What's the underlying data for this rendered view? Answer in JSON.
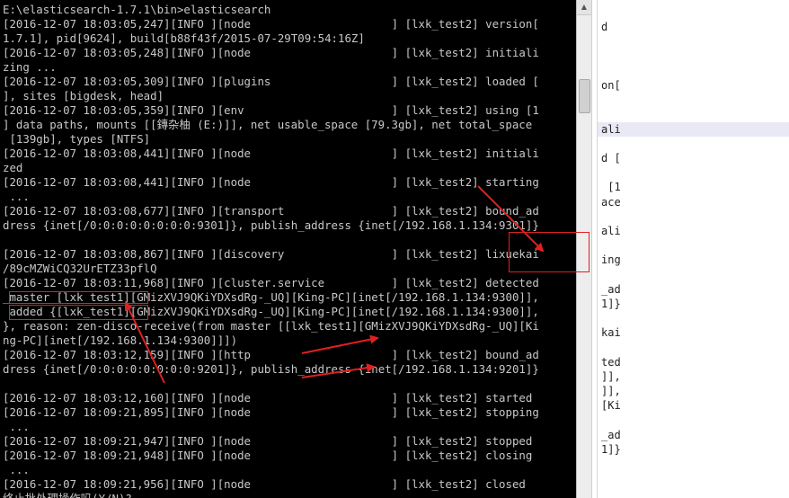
{
  "console": {
    "lines": [
      "E:\\elasticsearch-1.7.1\\bin>elasticsearch",
      "[2016-12-07 18:03:05,247][INFO ][node                     ] [lxk_test2] version[",
      "1.7.1], pid[9624], build[b88f43f/2015-07-29T09:54:16Z]",
      "[2016-12-07 18:03:05,248][INFO ][node                     ] [lxk_test2] initiali",
      "zing ...",
      "[2016-12-07 18:03:05,309][INFO ][plugins                  ] [lxk_test2] loaded [",
      "], sites [bigdesk, head]",
      "[2016-12-07 18:03:05,359][INFO ][env                      ] [lxk_test2] using [1",
      "] data paths, mounts [[鏄杂柚 (E:)]], net usable_space [79.3gb], net total_space",
      " [139gb], types [NTFS]",
      "[2016-12-07 18:03:08,441][INFO ][node                     ] [lxk_test2] initiali",
      "zed",
      "[2016-12-07 18:03:08,441][INFO ][node                     ] [lxk_test2] starting",
      " ...",
      "[2016-12-07 18:03:08,677][INFO ][transport                ] [lxk_test2] bound_ad",
      "dress {inet[/0:0:0:0:0:0:0:0:9301]}, publish_address {inet[/192.168.1.134:9301]}",
      "",
      "[2016-12-07 18:03:08,867][INFO ][discovery                ] [lxk_test2] lixuekai",
      "/89cMZWiCQ32UrETZ33pflQ",
      "[2016-12-07 18:03:11,968][INFO ][cluster.service          ] [lxk_test2] detected",
      "_master [lxk_test1][GMizXVJ9QKiYDXsdRg-_UQ][King-PC][inet[/192.168.1.134:9300]],",
      " added {[lxk_test1][GMizXVJ9QKiYDXsdRg-_UQ][King-PC][inet[/192.168.1.134:9300]],",
      "}, reason: zen-disco-receive(from master [[lxk_test1][GMizXVJ9QKiYDXsdRg-_UQ][Ki",
      "ng-PC][inet[/192.168.1.134:9300]]])",
      "[2016-12-07 18:03:12,159][INFO ][http                     ] [lxk_test2] bound_ad",
      "dress {inet[/0:0:0:0:0:0:0:0:9201]}, publish_address {inet[/192.168.1.134:9201]}",
      "",
      "[2016-12-07 18:03:12,160][INFO ][node                     ] [lxk_test2] started",
      "[2016-12-07 18:09:21,895][INFO ][node                     ] [lxk_test2] stopping",
      " ...",
      "[2016-12-07 18:09:21,947][INFO ][node                     ] [lxk_test2] stopped",
      "[2016-12-07 18:09:21,948][INFO ][node                     ] [lxk_test2] closing",
      " ...",
      "[2016-12-07 18:09:21,956][INFO ][node                     ] [lxk_test2] closed",
      "终止批处理操作吗(Y/N)?"
    ]
  },
  "right_pane": {
    "lines": [
      {
        "text": "d",
        "row": 1
      },
      {
        "text": "on[",
        "row": 5
      },
      {
        "text": "ali",
        "row": 8,
        "highlight": true
      },
      {
        "text": "d [",
        "row": 10
      },
      {
        "text": " [1",
        "row": 12
      },
      {
        "text": "ace",
        "row": 13
      },
      {
        "text": "ali",
        "row": 15
      },
      {
        "text": "ing",
        "row": 17
      },
      {
        "text": "_ad",
        "row": 19
      },
      {
        "text": "1]}",
        "row": 20
      },
      {
        "text": "kai",
        "row": 22
      },
      {
        "text": "ted",
        "row": 24
      },
      {
        "text": "]],",
        "row": 25
      },
      {
        "text": "]],",
        "row": 26
      },
      {
        "text": "[Ki",
        "row": 27
      },
      {
        "text": "_ad",
        "row": 29
      },
      {
        "text": "1]}",
        "row": 30
      }
    ]
  },
  "annotation_color": "#e02020"
}
